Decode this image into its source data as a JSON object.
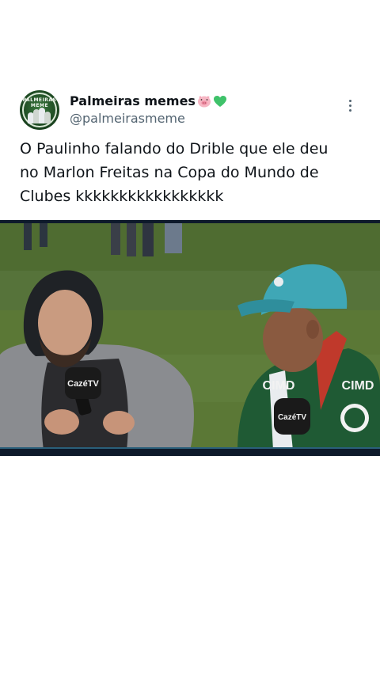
{
  "post": {
    "display_name": "Palmeiras memes",
    "handle": "@palmeirasmeme",
    "avatar_text": "PALMEIRAS MEME",
    "text_lines": [
      "O Paulinho falando do Drible que ele deu",
      "no Marlon Freitas na Copa do Mundo de",
      "Clubes kkkkkkkkkkkkkkkkk"
    ],
    "icons": {
      "more": "more-vertical-icon",
      "pig": "pig-face-emoji",
      "heart": "green-heart-emoji"
    }
  },
  "media": {
    "mic_flag_left": "CazéTV",
    "mic_flag_right": "CazéTV",
    "jersey_text_left": "CIMD",
    "jersey_text_right": "CIMD",
    "colors": {
      "pitch": "#5d7a3a",
      "jersey": "#1f5a34",
      "cap": "#3fa7b6"
    }
  }
}
